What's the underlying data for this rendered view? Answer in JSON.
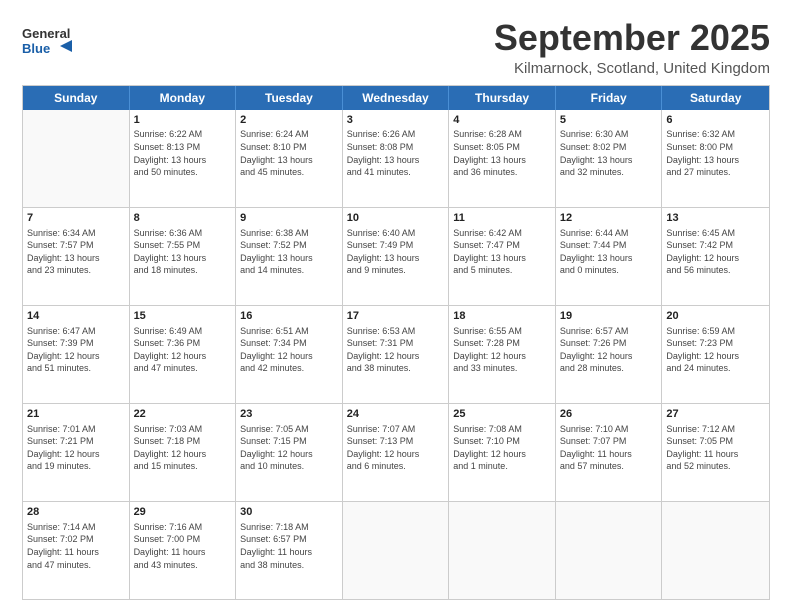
{
  "header": {
    "logo_general": "General",
    "logo_blue": "Blue",
    "title": "September 2025",
    "location": "Kilmarnock, Scotland, United Kingdom"
  },
  "calendar": {
    "weekdays": [
      "Sunday",
      "Monday",
      "Tuesday",
      "Wednesday",
      "Thursday",
      "Friday",
      "Saturday"
    ],
    "weeks": [
      [
        {
          "day": "",
          "info": ""
        },
        {
          "day": "1",
          "info": "Sunrise: 6:22 AM\nSunset: 8:13 PM\nDaylight: 13 hours\nand 50 minutes."
        },
        {
          "day": "2",
          "info": "Sunrise: 6:24 AM\nSunset: 8:10 PM\nDaylight: 13 hours\nand 45 minutes."
        },
        {
          "day": "3",
          "info": "Sunrise: 6:26 AM\nSunset: 8:08 PM\nDaylight: 13 hours\nand 41 minutes."
        },
        {
          "day": "4",
          "info": "Sunrise: 6:28 AM\nSunset: 8:05 PM\nDaylight: 13 hours\nand 36 minutes."
        },
        {
          "day": "5",
          "info": "Sunrise: 6:30 AM\nSunset: 8:02 PM\nDaylight: 13 hours\nand 32 minutes."
        },
        {
          "day": "6",
          "info": "Sunrise: 6:32 AM\nSunset: 8:00 PM\nDaylight: 13 hours\nand 27 minutes."
        }
      ],
      [
        {
          "day": "7",
          "info": "Sunrise: 6:34 AM\nSunset: 7:57 PM\nDaylight: 13 hours\nand 23 minutes."
        },
        {
          "day": "8",
          "info": "Sunrise: 6:36 AM\nSunset: 7:55 PM\nDaylight: 13 hours\nand 18 minutes."
        },
        {
          "day": "9",
          "info": "Sunrise: 6:38 AM\nSunset: 7:52 PM\nDaylight: 13 hours\nand 14 minutes."
        },
        {
          "day": "10",
          "info": "Sunrise: 6:40 AM\nSunset: 7:49 PM\nDaylight: 13 hours\nand 9 minutes."
        },
        {
          "day": "11",
          "info": "Sunrise: 6:42 AM\nSunset: 7:47 PM\nDaylight: 13 hours\nand 5 minutes."
        },
        {
          "day": "12",
          "info": "Sunrise: 6:44 AM\nSunset: 7:44 PM\nDaylight: 13 hours\nand 0 minutes."
        },
        {
          "day": "13",
          "info": "Sunrise: 6:45 AM\nSunset: 7:42 PM\nDaylight: 12 hours\nand 56 minutes."
        }
      ],
      [
        {
          "day": "14",
          "info": "Sunrise: 6:47 AM\nSunset: 7:39 PM\nDaylight: 12 hours\nand 51 minutes."
        },
        {
          "day": "15",
          "info": "Sunrise: 6:49 AM\nSunset: 7:36 PM\nDaylight: 12 hours\nand 47 minutes."
        },
        {
          "day": "16",
          "info": "Sunrise: 6:51 AM\nSunset: 7:34 PM\nDaylight: 12 hours\nand 42 minutes."
        },
        {
          "day": "17",
          "info": "Sunrise: 6:53 AM\nSunset: 7:31 PM\nDaylight: 12 hours\nand 38 minutes."
        },
        {
          "day": "18",
          "info": "Sunrise: 6:55 AM\nSunset: 7:28 PM\nDaylight: 12 hours\nand 33 minutes."
        },
        {
          "day": "19",
          "info": "Sunrise: 6:57 AM\nSunset: 7:26 PM\nDaylight: 12 hours\nand 28 minutes."
        },
        {
          "day": "20",
          "info": "Sunrise: 6:59 AM\nSunset: 7:23 PM\nDaylight: 12 hours\nand 24 minutes."
        }
      ],
      [
        {
          "day": "21",
          "info": "Sunrise: 7:01 AM\nSunset: 7:21 PM\nDaylight: 12 hours\nand 19 minutes."
        },
        {
          "day": "22",
          "info": "Sunrise: 7:03 AM\nSunset: 7:18 PM\nDaylight: 12 hours\nand 15 minutes."
        },
        {
          "day": "23",
          "info": "Sunrise: 7:05 AM\nSunset: 7:15 PM\nDaylight: 12 hours\nand 10 minutes."
        },
        {
          "day": "24",
          "info": "Sunrise: 7:07 AM\nSunset: 7:13 PM\nDaylight: 12 hours\nand 6 minutes."
        },
        {
          "day": "25",
          "info": "Sunrise: 7:08 AM\nSunset: 7:10 PM\nDaylight: 12 hours\nand 1 minute."
        },
        {
          "day": "26",
          "info": "Sunrise: 7:10 AM\nSunset: 7:07 PM\nDaylight: 11 hours\nand 57 minutes."
        },
        {
          "day": "27",
          "info": "Sunrise: 7:12 AM\nSunset: 7:05 PM\nDaylight: 11 hours\nand 52 minutes."
        }
      ],
      [
        {
          "day": "28",
          "info": "Sunrise: 7:14 AM\nSunset: 7:02 PM\nDaylight: 11 hours\nand 47 minutes."
        },
        {
          "day": "29",
          "info": "Sunrise: 7:16 AM\nSunset: 7:00 PM\nDaylight: 11 hours\nand 43 minutes."
        },
        {
          "day": "30",
          "info": "Sunrise: 7:18 AM\nSunset: 6:57 PM\nDaylight: 11 hours\nand 38 minutes."
        },
        {
          "day": "",
          "info": ""
        },
        {
          "day": "",
          "info": ""
        },
        {
          "day": "",
          "info": ""
        },
        {
          "day": "",
          "info": ""
        }
      ]
    ]
  }
}
